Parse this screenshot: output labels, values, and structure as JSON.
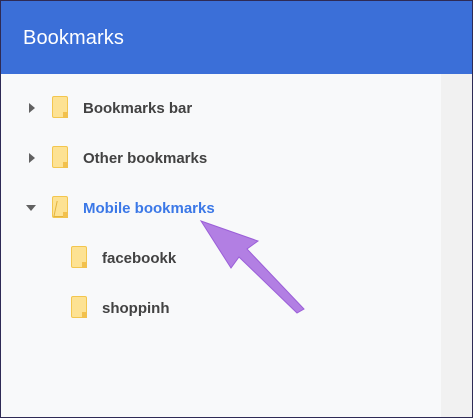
{
  "header": {
    "title": "Bookmarks"
  },
  "tree": [
    {
      "label": "Bookmarks bar",
      "expanded": false,
      "selected": false,
      "level": 0
    },
    {
      "label": "Other bookmarks",
      "expanded": false,
      "selected": false,
      "level": 0
    },
    {
      "label": "Mobile bookmarks",
      "expanded": true,
      "selected": true,
      "level": 0
    },
    {
      "label": "facebookk",
      "expanded": false,
      "selected": false,
      "level": 1
    },
    {
      "label": "shoppinh",
      "expanded": false,
      "selected": false,
      "level": 1
    }
  ],
  "colors": {
    "header": "#3b6fd8",
    "selected_text": "#3b78e7",
    "folder": "#fde293",
    "annotation_arrow": "#b27fe3"
  },
  "annotation": {
    "icon": "purple-pointer-arrow"
  }
}
